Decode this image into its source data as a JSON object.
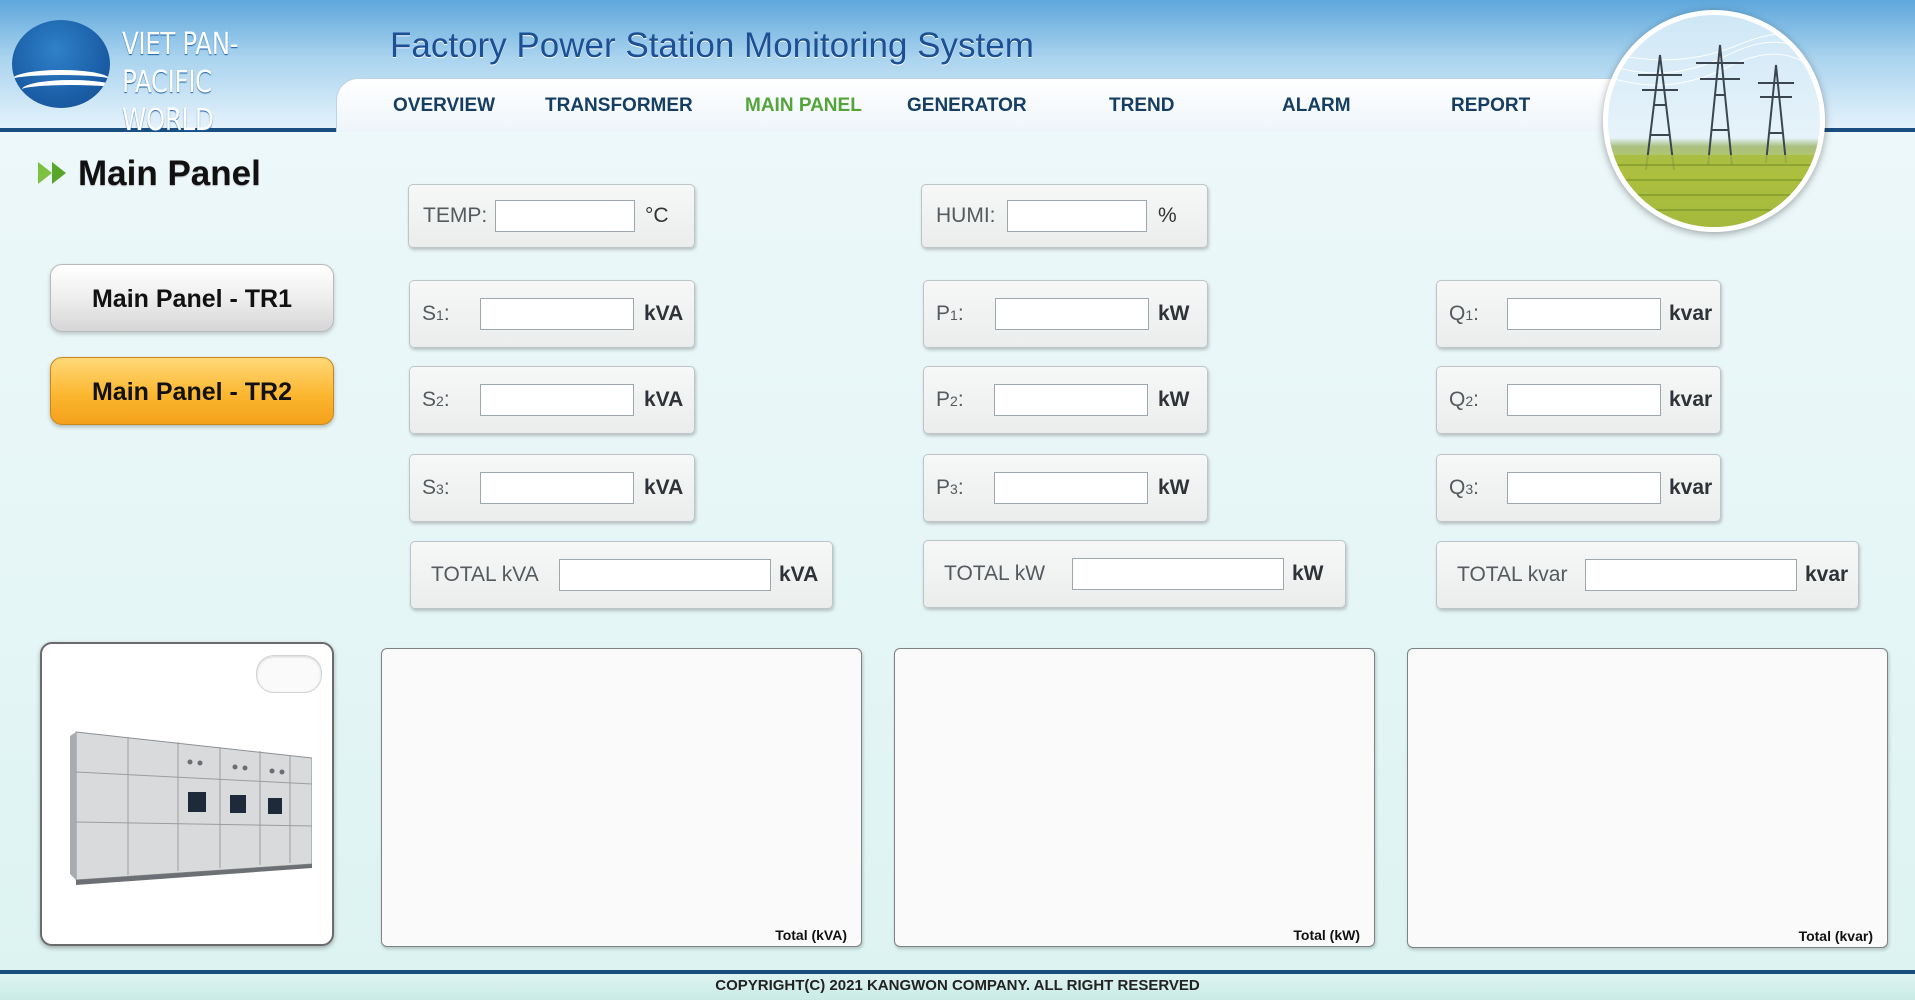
{
  "brand": {
    "line1": "VIET PAN-PACIFIC",
    "line2": "WORLD"
  },
  "app_title": "Factory Power Station Monitoring System",
  "nav": {
    "items": [
      "OVERVIEW",
      "TRANSFORMER",
      "MAIN PANEL",
      "GENERATOR",
      "TREND",
      "ALARM",
      "REPORT"
    ],
    "active": "MAIN PANEL"
  },
  "page_title": "Main Panel",
  "panel_buttons": {
    "tr1": "Main Panel - TR1",
    "tr2": "Main Panel - TR2"
  },
  "env": {
    "temp": {
      "label": "TEMP:",
      "value": "",
      "unit": "°C"
    },
    "humi": {
      "label": "HUMI:",
      "value": "",
      "unit": "%"
    }
  },
  "readings": {
    "s": [
      {
        "letter": "S",
        "num": "1",
        "value": "",
        "unit": "kVA"
      },
      {
        "letter": "S",
        "num": "2",
        "value": "",
        "unit": "kVA"
      },
      {
        "letter": "S",
        "num": "3",
        "value": "",
        "unit": "kVA"
      }
    ],
    "p": [
      {
        "letter": "P",
        "num": "1",
        "value": "",
        "unit": "kW"
      },
      {
        "letter": "P",
        "num": "2",
        "value": "",
        "unit": "kW"
      },
      {
        "letter": "P",
        "num": "3",
        "value": "",
        "unit": "kW"
      }
    ],
    "q": [
      {
        "letter": "Q",
        "num": "1",
        "value": "",
        "unit": "kvar"
      },
      {
        "letter": "Q",
        "num": "2",
        "value": "",
        "unit": "kvar"
      },
      {
        "letter": "Q",
        "num": "3",
        "value": "",
        "unit": "kvar"
      }
    ]
  },
  "totals": {
    "kva": {
      "label": "TOTAL kVA",
      "value": "",
      "unit": "kVA"
    },
    "kw": {
      "label": "TOTAL kW",
      "value": "",
      "unit": "kW"
    },
    "kvar": {
      "label": "TOTAL kvar",
      "value": "",
      "unit": "kvar"
    }
  },
  "charts": {
    "kva": "Total (kVA)",
    "kw": "Total (kW)",
    "kvar": "Total (kvar)"
  },
  "footer": "COPYRIGHT(C) 2021 KANGWON COMPANY. ALL RIGHT RESERVED",
  "colors": {
    "accent_blue": "#1c4f93",
    "nav_active": "#54a43b",
    "tr2_button": "#fbb731",
    "header_dark": "#1a4e7e"
  },
  "icons": {
    "logo": "wave-logo-icon",
    "heading": "double-arrow-icon"
  }
}
